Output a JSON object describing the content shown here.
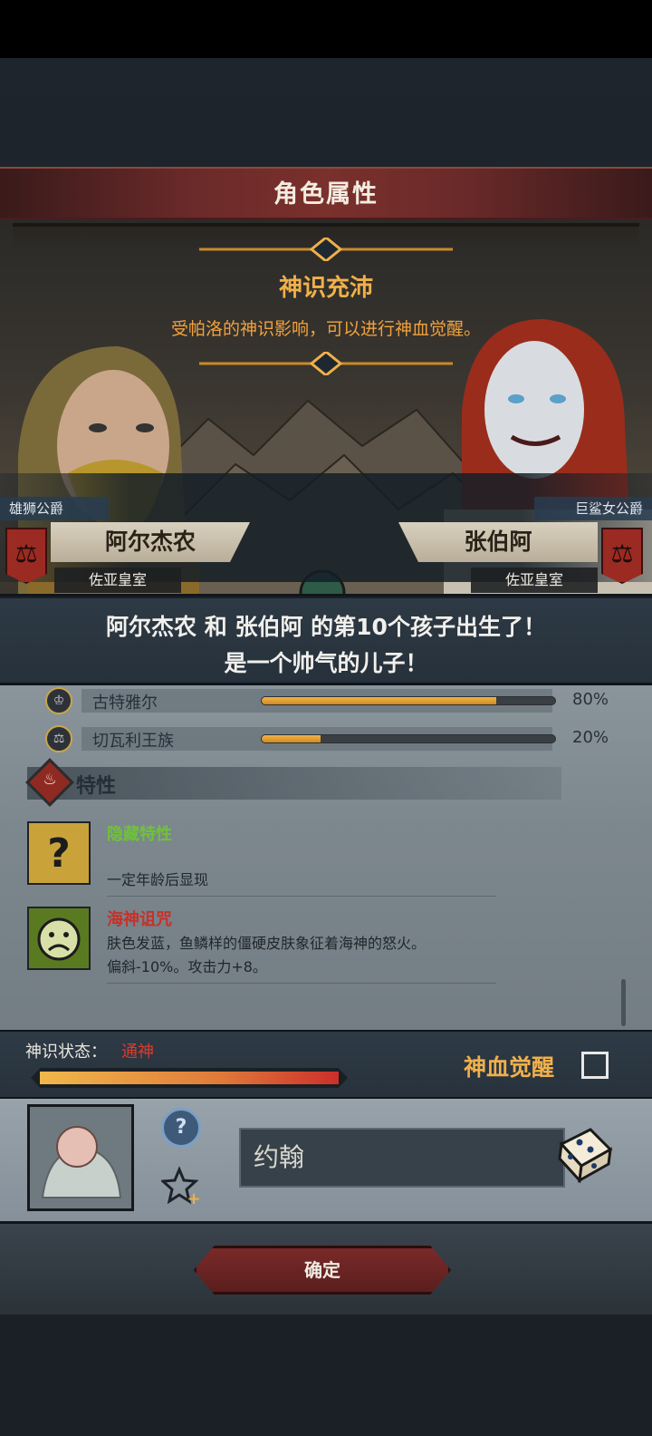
{
  "header": {
    "title": "角色属性"
  },
  "event": {
    "title": "神识充沛",
    "description": "受帕洛的神识影响，可以进行神血觉醒。"
  },
  "parents": {
    "father": {
      "title": "雄狮公爵",
      "name": "阿尔杰农",
      "house": "佐亚皇室",
      "banner_icon": "scales-icon"
    },
    "mother": {
      "title": "巨鲨女公爵",
      "name": "张伯阿",
      "house": "佐亚皇室",
      "banner_icon": "scales-icon"
    }
  },
  "announcement": {
    "line1": "阿尔杰农 和 张伯阿 的第10个孩子出生了！",
    "line2": "是一个帅气的儿子！"
  },
  "bloodlines": [
    {
      "icon": "crown-icon",
      "name": "古特雅尔",
      "percent": 80,
      "percent_label": "80%"
    },
    {
      "icon": "scales-icon",
      "name": "切瓦利王族",
      "percent": 20,
      "percent_label": "20%"
    }
  ],
  "traits": {
    "label": "特性",
    "items": [
      {
        "icon": "question-icon",
        "name": "隐藏特性",
        "name_color": "#6fc23a",
        "desc1": "",
        "desc2": "一定年龄后显现"
      },
      {
        "icon": "sad-face-icon",
        "name": "海神诅咒",
        "name_color": "#c8302a",
        "desc1": "肤色发蓝，鱼鳞样的僵硬皮肤象征着海神的怒火。",
        "desc2": "偏斜-10%。攻击力+8。"
      }
    ]
  },
  "divine_status": {
    "label": "神识状态：",
    "value": "通神",
    "level": 1.0,
    "awaken_label": "神血觉醒",
    "awaken_checked": false
  },
  "child": {
    "name": "约翰"
  },
  "confirm": {
    "label": "确定"
  },
  "colors": {
    "accent": "#f0b04a",
    "danger": "#e0392c",
    "confirm": "#7a2a28"
  }
}
